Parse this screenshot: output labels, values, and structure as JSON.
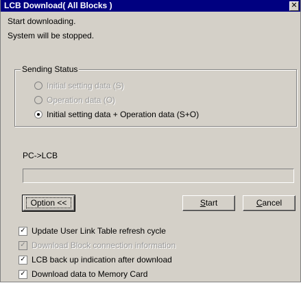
{
  "window": {
    "title": "LCB Download( All Blocks )",
    "close_icon": "close-icon"
  },
  "messages": {
    "line1": "Start downloading.",
    "line2": "System will be stopped."
  },
  "sending_status": {
    "legend": "Sending Status",
    "options": [
      {
        "label": "Initial setting data (S)",
        "checked": false,
        "enabled": false
      },
      {
        "label": "Operation data (O)",
        "checked": false,
        "enabled": false
      },
      {
        "label": "Initial setting data + Operation data (S+O)",
        "checked": true,
        "enabled": true
      }
    ]
  },
  "progress": {
    "label": "PC->LCB",
    "value_percent": 0
  },
  "buttons": {
    "option": "Option <<",
    "start_prefix": "",
    "start_underlined": "S",
    "start_suffix": "tart",
    "cancel_underlined": "C",
    "cancel_suffix": "ancel"
  },
  "checkboxes": [
    {
      "label": "Update User Link Table refresh cycle",
      "checked": true,
      "enabled": true
    },
    {
      "label": "Download Block connection information",
      "checked": true,
      "enabled": false
    },
    {
      "label": "LCB back up indication after download",
      "checked": true,
      "enabled": true
    },
    {
      "label": "Download data to Memory Card",
      "checked": true,
      "enabled": true
    }
  ]
}
